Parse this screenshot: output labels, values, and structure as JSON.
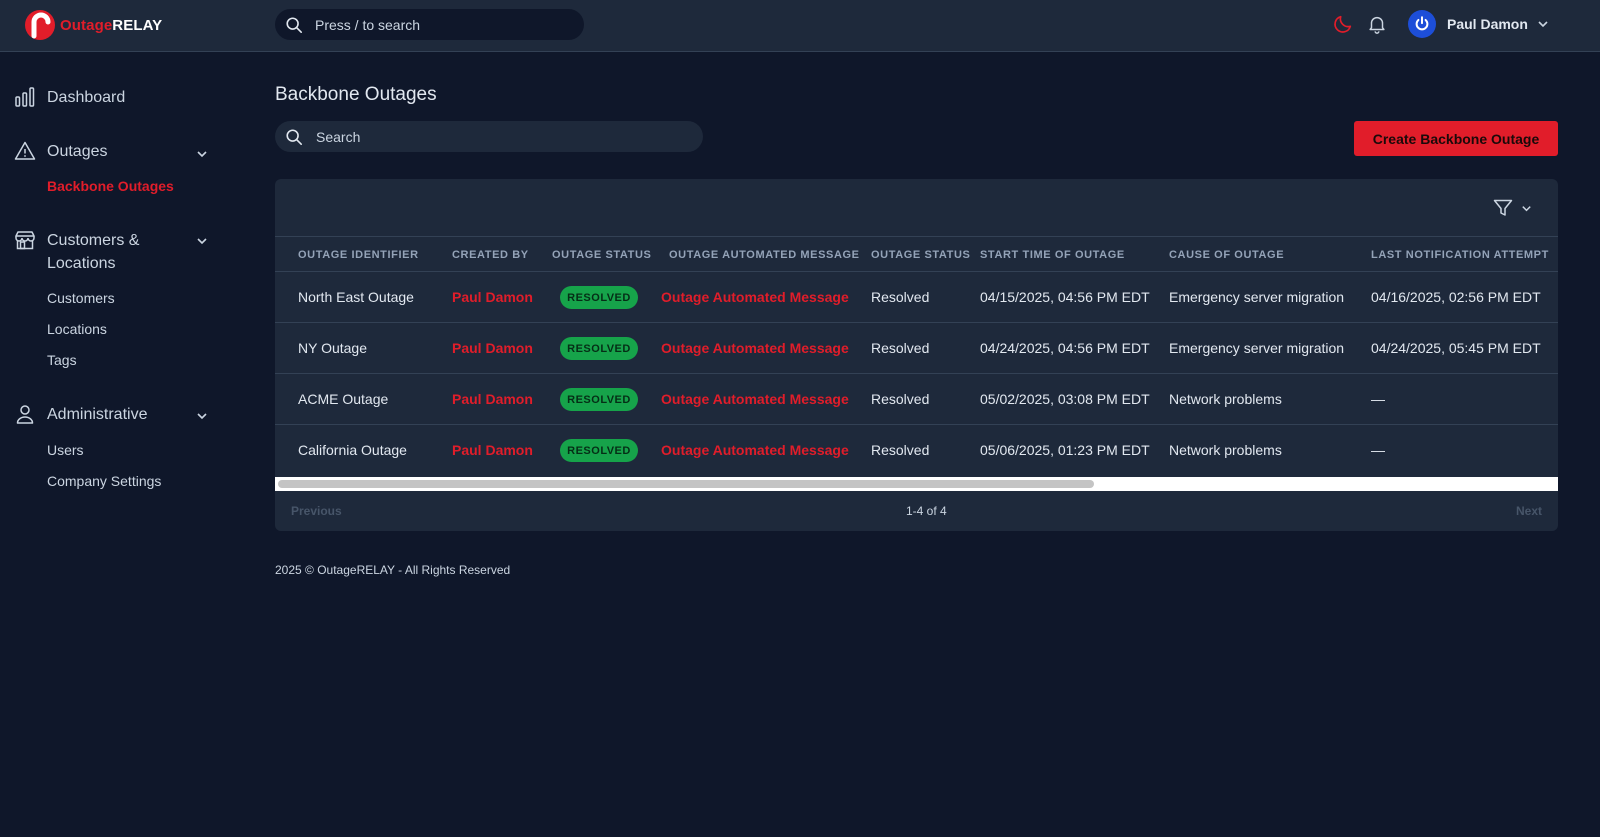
{
  "app": {
    "brand_part1": "Outage",
    "brand_part2": "RELAY",
    "search_placeholder": "Press / to search",
    "user_name": "Paul Damon"
  },
  "sidebar": {
    "dashboard": "Dashboard",
    "outages": "Outages",
    "outages_sub": [
      "Backbone Outages"
    ],
    "customers_line1": "Customers &",
    "customers_line2": "Locations",
    "customers_sub": [
      "Customers",
      "Locations",
      "Tags"
    ],
    "administrative": "Administrative",
    "admin_sub": [
      "Users",
      "Company Settings"
    ]
  },
  "main": {
    "title": "Backbone Outages",
    "search_placeholder": "Search",
    "create_button": "Create Backbone Outage",
    "columns": [
      "OUTAGE IDENTIFIER",
      "CREATED BY",
      "OUTAGE STATUS",
      "OUTAGE AUTOMATED MESSAGE",
      "OUTAGE STATUS",
      "START TIME OF OUTAGE",
      "CAUSE OF OUTAGE",
      "LAST NOTIFICATION ATTEMPT"
    ],
    "rows": [
      {
        "identifier": "North East Outage",
        "created_by": "Paul Damon",
        "badge": "RESOLVED",
        "message": "Outage Automated Message",
        "status": "Resolved",
        "start": "04/15/2025, 04:56 PM EDT",
        "cause": "Emergency server migration",
        "last": "04/16/2025, 02:56 PM EDT"
      },
      {
        "identifier": "NY Outage",
        "created_by": "Paul Damon",
        "badge": "RESOLVED",
        "message": "Outage Automated Message",
        "status": "Resolved",
        "start": "04/24/2025, 04:56 PM EDT",
        "cause": "Emergency server migration",
        "last": "04/24/2025, 05:45 PM EDT"
      },
      {
        "identifier": "ACME Outage",
        "created_by": "Paul Damon",
        "badge": "RESOLVED",
        "message": "Outage Automated Message",
        "status": "Resolved",
        "start": "05/02/2025, 03:08 PM EDT",
        "cause": "Network problems",
        "last": "—"
      },
      {
        "identifier": "California Outage",
        "created_by": "Paul Damon",
        "badge": "RESOLVED",
        "message": "Outage Automated Message",
        "status": "Resolved",
        "start": "05/06/2025, 01:23 PM EDT",
        "cause": "Network problems",
        "last": "—"
      }
    ],
    "pager": {
      "previous": "Previous",
      "count": "1-4 of 4",
      "next": "Next"
    },
    "footer": "2025 © OutageRELAY - All Rights Reserved"
  },
  "colors": {
    "accent": "#e11d2a",
    "badge": "#16a34a",
    "background": "#0f172a",
    "surface": "#1e293b"
  }
}
